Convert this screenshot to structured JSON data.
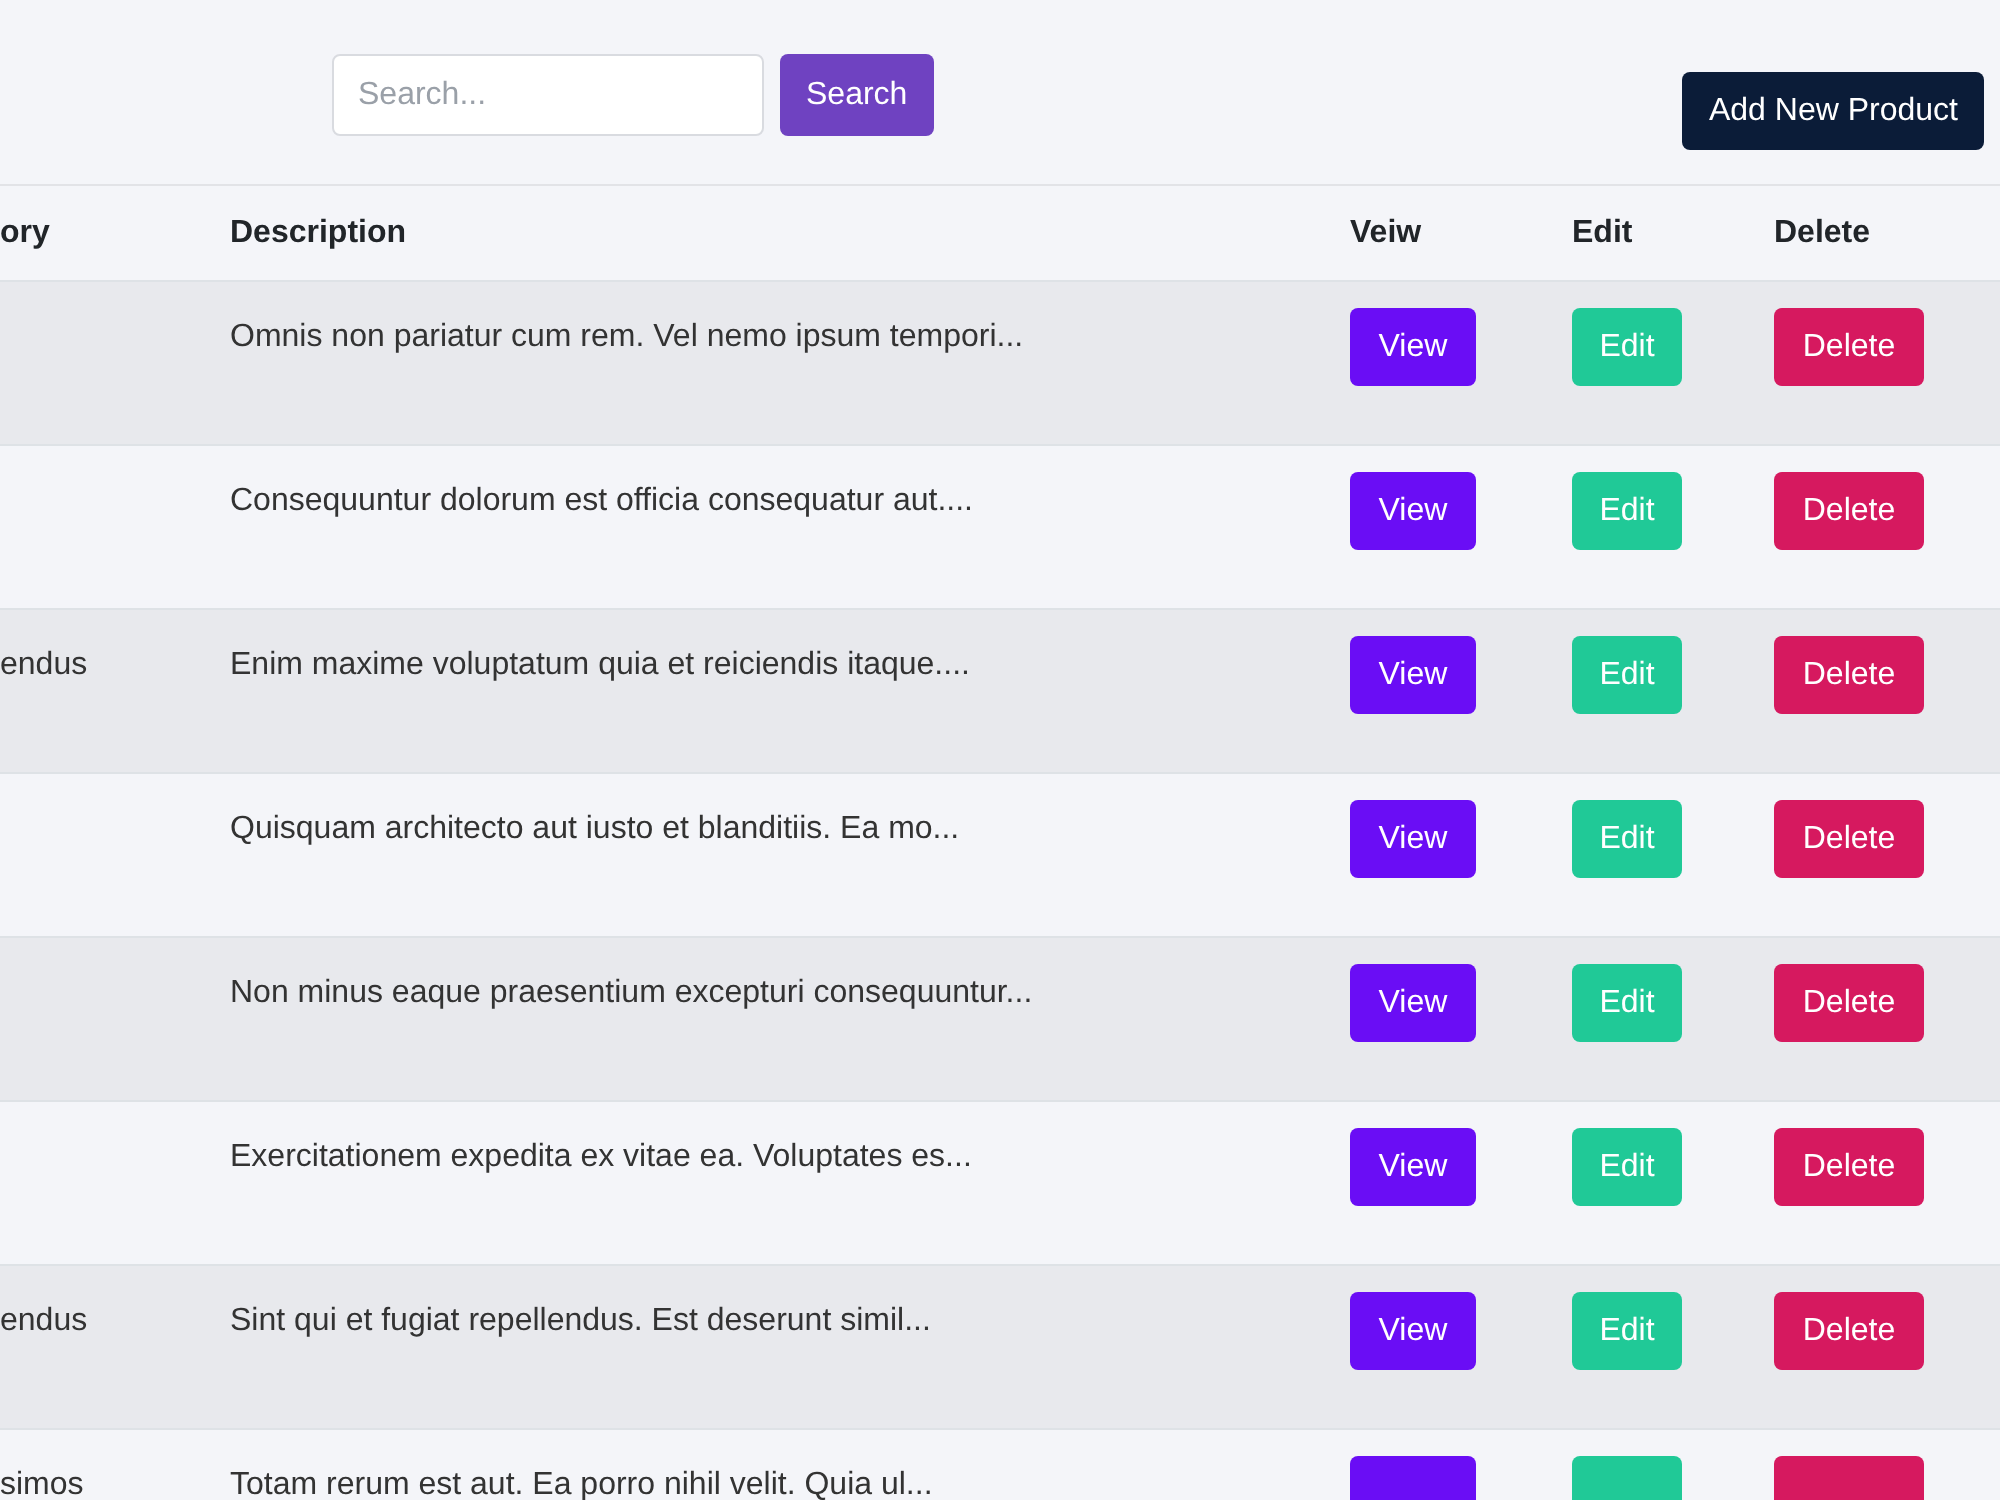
{
  "search": {
    "placeholder": "Search...",
    "button": "Search"
  },
  "add_button": "Add New Product",
  "table": {
    "columns": [
      "ory",
      "Description",
      "Veiw",
      "Edit",
      "Delete"
    ],
    "rows": [
      {
        "column_1": "",
        "description": "Omnis non pariatur cum rem. Vel nemo ipsum tempori...",
        "view": "View",
        "edit": "Edit",
        "delete": "Delete"
      },
      {
        "column_1": "",
        "description": "Consequuntur dolorum est officia consequatur aut....",
        "view": "View",
        "edit": "Edit",
        "delete": "Delete"
      },
      {
        "column_1": "endus",
        "description": "Enim maxime voluptatum quia et reiciendis itaque....",
        "view": "View",
        "edit": "Edit",
        "delete": "Delete"
      },
      {
        "column_1": "",
        "description": "Quisquam architecto aut iusto et blanditiis. Ea mo...",
        "view": "View",
        "edit": "Edit",
        "delete": "Delete"
      },
      {
        "column_1": "",
        "description": "Non minus eaque praesentium excepturi consequuntur...",
        "view": "View",
        "edit": "Edit",
        "delete": "Delete"
      },
      {
        "column_1": "",
        "description": "Exercitationem expedita ex vitae ea. Voluptates es...",
        "view": "View",
        "edit": "Edit",
        "delete": "Delete"
      },
      {
        "column_1": "endus",
        "description": "Sint qui et fugiat repellendus. Est deserunt simil...",
        "view": "View",
        "edit": "Edit",
        "delete": "Delete"
      },
      {
        "column_1": "simos",
        "description": "Totam rerum est aut. Ea porro nihil velit. Quia ul..."
      }
    ]
  }
}
